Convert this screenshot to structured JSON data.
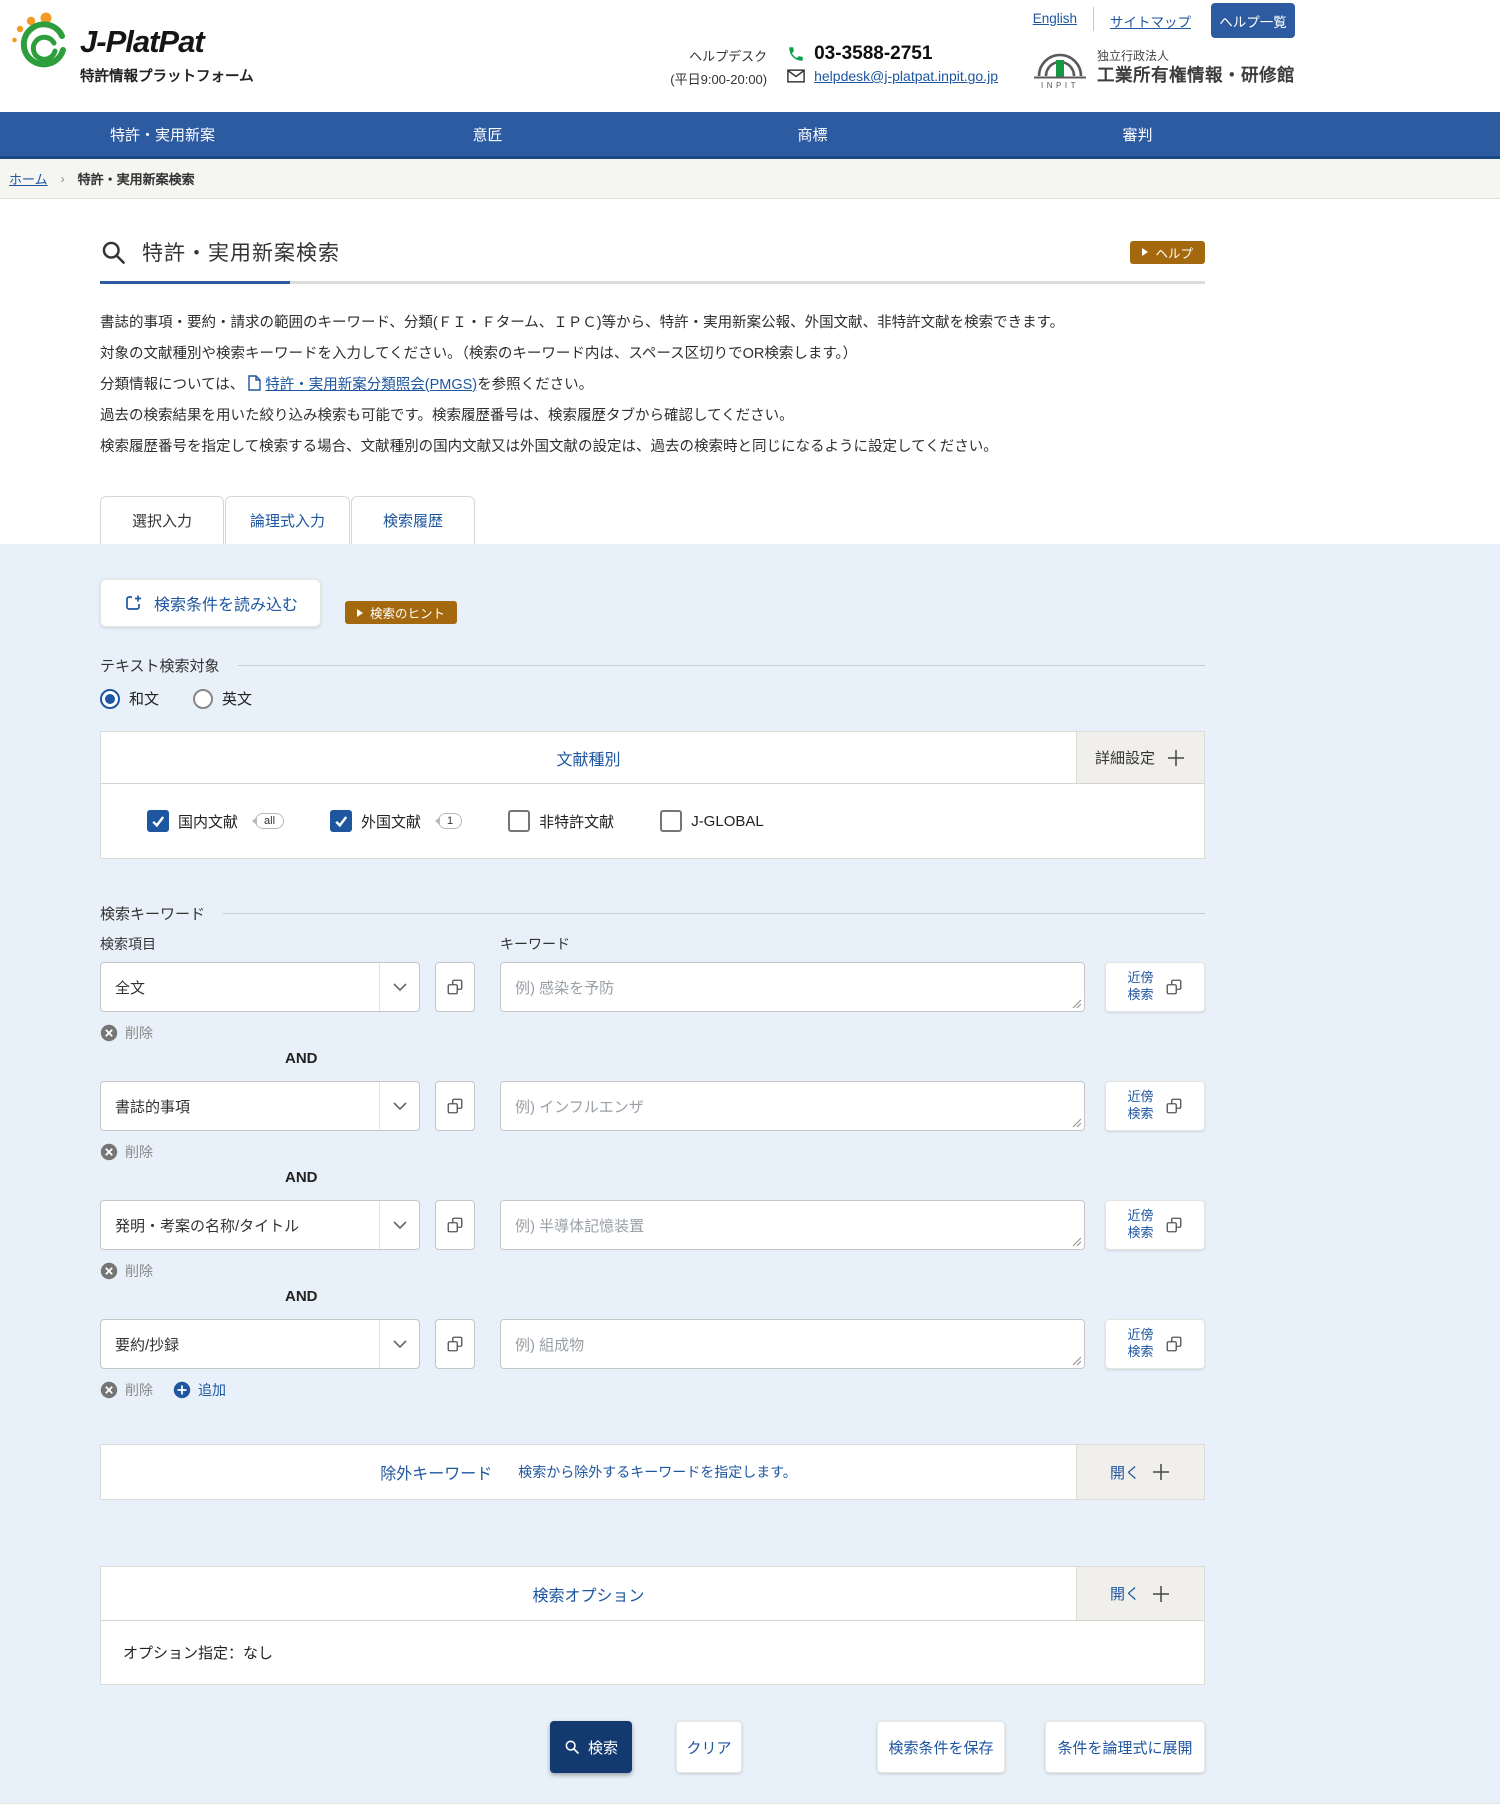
{
  "colors": {
    "nav_blue": "#2d5ba1",
    "link_blue": "#1e56a0",
    "form_bg_blue": "#e8f1f9",
    "help_brown": "#a4690e",
    "search_button_navy": "#123a70",
    "logo_green": "#2e9e3c",
    "logo_orange": "#f59a23"
  },
  "header": {
    "logo_title": "J-PlatPat",
    "logo_subtitle": "特許情報プラットフォーム",
    "top_links": {
      "english": "English",
      "sitemap": "サイトマップ",
      "help_list": "ヘルプ一覧"
    },
    "helpdesk": {
      "label": "ヘルプデスク",
      "hours": "(平日9:00-20:00)",
      "phone": "03-3588-2751",
      "email": "helpdesk@j-platpat.inpit.go.jp"
    },
    "inpit": {
      "logo_text": "INPIT",
      "org_type": "独立行政法人",
      "org_name": "工業所有権情報・研修館"
    }
  },
  "nav": {
    "items": [
      {
        "label": "特許・実用新案"
      },
      {
        "label": "意匠"
      },
      {
        "label": "商標"
      },
      {
        "label": "審判"
      }
    ]
  },
  "breadcrumb": {
    "home": "ホーム",
    "separator": "›",
    "current": "特許・実用新案検索"
  },
  "page": {
    "title": "特許・実用新案検索",
    "help_button": "ヘルプ",
    "description": [
      "書誌的事項・要約・請求の範囲のキーワード、分類(ＦＩ・Ｆターム、ＩＰＣ)等から、特許・実用新案公報、外国文献、非特許文献を検索できます。",
      "対象の文献種別や検索キーワードを入力してください。（検索のキーワード内は、スペース区切りでOR検索します。）"
    ],
    "classification_note": {
      "prefix": "分類情報については、",
      "link": "特許・実用新案分類照会(PMGS)",
      "suffix": "を参照ください。"
    },
    "description2": [
      "過去の検索結果を用いた絞り込み検索も可能です。検索履歴番号は、検索履歴タブから確認してください。",
      "検索履歴番号を指定して検索する場合、文献種別の国内文献又は外国文献の設定は、過去の検索時と同じになるように設定してください。"
    ]
  },
  "tabs": [
    {
      "label": "選択入力",
      "active": true
    },
    {
      "label": "論理式入力",
      "active": false
    },
    {
      "label": "検索履歴",
      "active": false
    }
  ],
  "form": {
    "load_button": "検索条件を読み込む",
    "hint_button": "検索のヒント",
    "text_target": {
      "title": "テキスト検索対象",
      "options": [
        {
          "label": "和文",
          "selected": true
        },
        {
          "label": "英文",
          "selected": false
        }
      ]
    },
    "doc_type": {
      "title": "文献種別",
      "detail_button": "詳細設定",
      "options": [
        {
          "label": "国内文献",
          "checked": true,
          "badge": "all"
        },
        {
          "label": "外国文献",
          "checked": true,
          "badge": "1"
        },
        {
          "label": "非特許文献",
          "checked": false
        },
        {
          "label": "J-GLOBAL",
          "checked": false
        }
      ]
    },
    "keywords": {
      "title": "検索キーワード",
      "field_column_label": "検索項目",
      "keyword_column_label": "キーワード",
      "operator": "AND",
      "delete_label": "削除",
      "add_label": "追加",
      "proximity_label": "近傍検索",
      "rows": [
        {
          "field": "全文",
          "placeholder": "例) 感染を予防"
        },
        {
          "field": "書誌的事項",
          "placeholder": "例) インフルエンザ",
          "and_before": true
        },
        {
          "field": "発明・考案の名称/タイトル",
          "placeholder": "例) 半導体記憶装置",
          "and_before": true
        },
        {
          "field": "要約/抄録",
          "placeholder": "例) 組成物",
          "and_before": true,
          "add": true
        }
      ]
    },
    "exclude": {
      "title": "除外キーワード",
      "description": "検索から除外するキーワードを指定します。",
      "open_label": "開く"
    },
    "options": {
      "title": "検索オプション",
      "open_label": "開く",
      "body": "オプション指定：なし"
    },
    "actions": {
      "search": "検索",
      "clear": "クリア",
      "save": "検索条件を保存",
      "expand": "条件を論理式に展開"
    }
  }
}
